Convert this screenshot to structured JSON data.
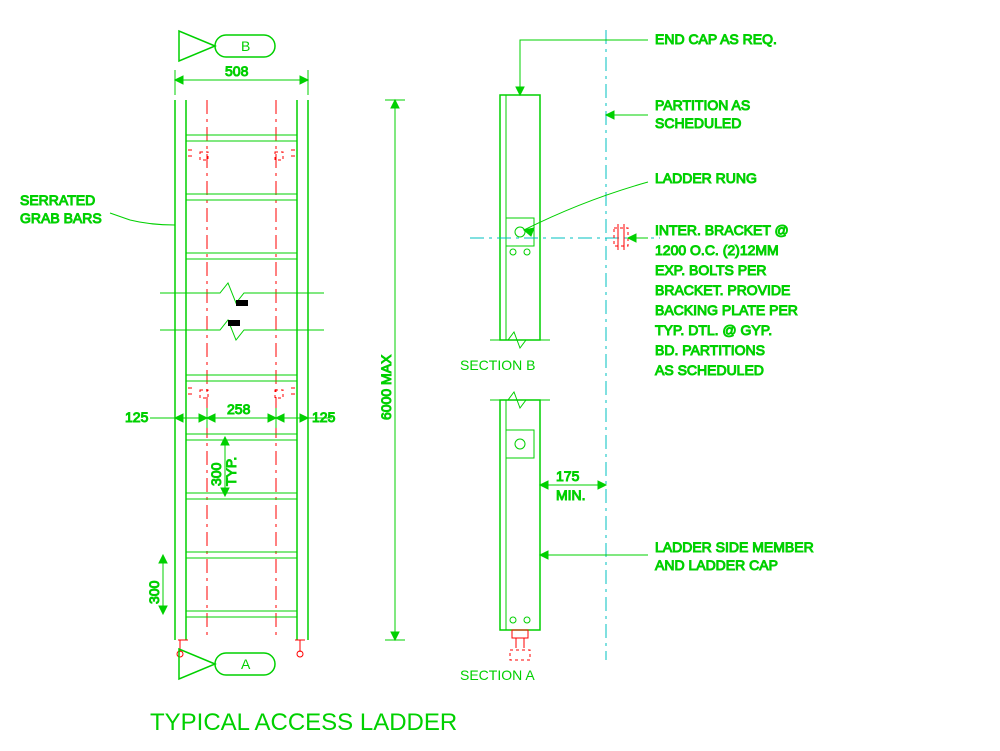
{
  "title": "TYPICAL ACCESS LADDER",
  "markers": {
    "top": "B",
    "bottom": "A"
  },
  "sectionLabels": {
    "a": "SECTION A",
    "b": "SECTION B"
  },
  "dims": {
    "width508": "508",
    "height": "6000 MAX",
    "gap258": "258",
    "side125a": "125",
    "side125b": "125",
    "rung300": "300",
    "rungTyp": "TYP.",
    "bottom300": "300",
    "clear175": "175",
    "clearMin": "MIN."
  },
  "labels": {
    "serrated1": "SERRATED",
    "serrated2": "GRAB BARS",
    "endcap": "END CAP AS REQ.",
    "partition1": "PARTITION AS",
    "partition2": "SCHEDULED",
    "rung": "LADDER RUNG",
    "bracket1": "INTER. BRACKET @",
    "bracket2": "1200 O.C. (2)12MM",
    "bracket3": "EXP. BOLTS PER",
    "bracket4": "BRACKET.  PROVIDE",
    "bracket5": "BACKING PLATE PER",
    "bracket6": "TYP. DTL. @ GYP.",
    "bracket7": "BD. PARTITIONS",
    "bracket8": "AS SCHEDULED",
    "side1": "LADDER SIDE MEMBER",
    "side2": "AND LADDER CAP"
  }
}
